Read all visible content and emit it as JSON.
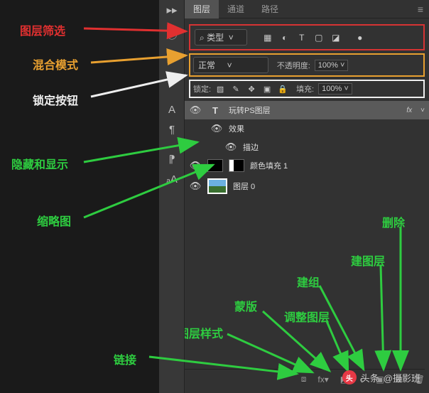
{
  "tabs": {
    "layers": "图层",
    "channels": "通道",
    "paths": "路径"
  },
  "filter": {
    "type_label": "类型"
  },
  "blend": {
    "mode": "正常",
    "opacity_label": "不透明度:",
    "opacity": "100%"
  },
  "lock": {
    "label": "锁定:",
    "fill_label": "填充:",
    "fill": "100%"
  },
  "layers_list": [
    {
      "name": "玩转PS图层",
      "type": "T",
      "fx": "fx"
    },
    {
      "name": "效果",
      "sub": true
    },
    {
      "name": "描边",
      "sub": true
    },
    {
      "name": "颜色填充 1",
      "type": "swatch"
    },
    {
      "name": "图层 0",
      "type": "img"
    }
  ],
  "annotations": {
    "filter": "图层筛选",
    "blend": "混合模式",
    "lock": "锁定按钮",
    "visibility": "隐藏和显示",
    "thumb": "缩略图",
    "link": "链接",
    "style": "图层样式",
    "mask": "蒙版",
    "adjust": "调整图层",
    "group": "建组",
    "newlayer": "建图层",
    "delete": "删除"
  },
  "watermark": {
    "brand": "头条",
    "author": "@摄影班"
  }
}
